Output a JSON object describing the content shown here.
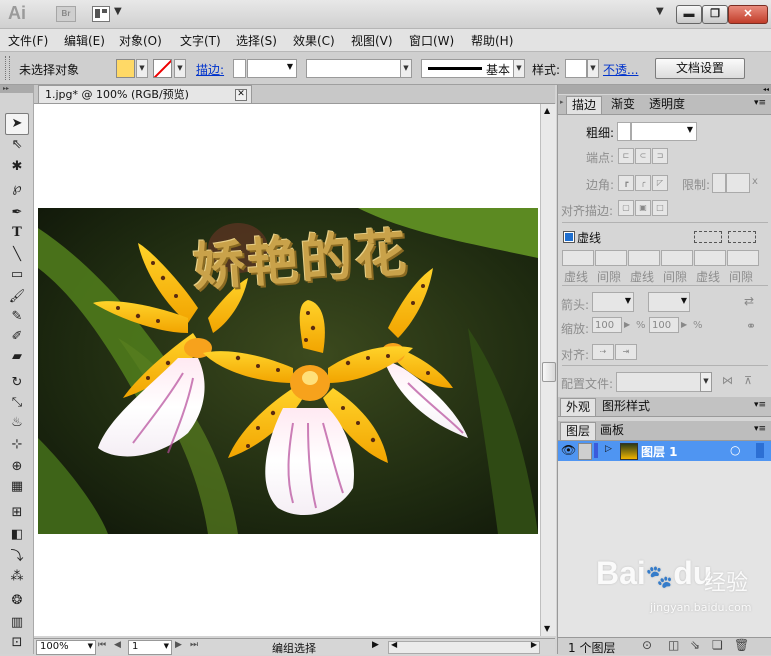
{
  "app": {
    "logo": "Ai",
    "bridge": "Br"
  },
  "window": {
    "min": "▬",
    "max": "❐",
    "close": "✕",
    "dropdown": "▼"
  },
  "menu": [
    "文件(F)",
    "编辑(E)",
    "对象(O)",
    "文字(T)",
    "选择(S)",
    "效果(C)",
    "视图(V)",
    "窗口(W)",
    "帮助(H)"
  ],
  "control": {
    "selection": "未选择对象",
    "stroke_label": "描边:",
    "profile": "基本",
    "style_label": "样式:",
    "opacity_link": "不透...",
    "doc_settings": "文档设置",
    "fill_color": "#ffd966"
  },
  "document": {
    "tab_title": "1.jpg* @ 100% (RGB/预览)",
    "artwork_text": "娇艳的花"
  },
  "status": {
    "zoom": "100%",
    "page": "1",
    "mode": "编组选择"
  },
  "stroke_panel": {
    "tabs": [
      "描边",
      "渐变",
      "透明度"
    ],
    "weight_label": "粗细:",
    "cap_label": "端点:",
    "corner_label": "边角:",
    "limit_label": "限制:",
    "limit_x": "x",
    "align_label": "对齐描边:",
    "dashed_label": "虚线",
    "dash_labels": [
      "虚线",
      "间隙",
      "虚线",
      "间隙",
      "虚线",
      "间隙"
    ],
    "arrow_label": "箭头:",
    "scale_label": "缩放:",
    "scale_start": "100",
    "scale_end": "100",
    "percent": "%",
    "arrow_align_label": "对齐:",
    "profile_label": "配置文件:"
  },
  "appearance_panel": {
    "tabs": [
      "外观",
      "图形样式"
    ]
  },
  "layers_panel": {
    "tabs": [
      "图层",
      "画板"
    ],
    "layers": [
      {
        "name": "图层 1"
      }
    ],
    "count": "1 个图层"
  },
  "watermark": {
    "brand": "Bai",
    "brand2": "du",
    "jingyan": "经验",
    "url": "jingyan.baidu.com"
  }
}
